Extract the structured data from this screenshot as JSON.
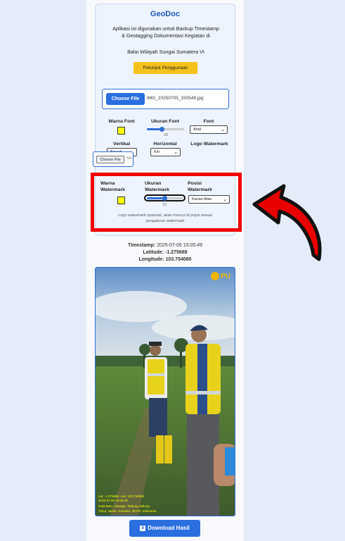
{
  "app": {
    "title": "GeoDoc",
    "description_line1": "Aplikasi ini digunakan untuk Backup Timestamp",
    "description_line2": "& Geotagging Dokumentasi Kegiatan di",
    "description_line3": "Balai Wilayah Sungai Sumatera VI",
    "guide_button": "Petunjuk Penggunaan"
  },
  "upload": {
    "choose_label": "Choose File",
    "file_name": "IMG_20250705_150549.jpg"
  },
  "settings": {
    "font_color_label": "Warna Font",
    "font_color": "#ffff00",
    "font_size_label": "Ukuran Font",
    "font_size_value": "28",
    "font_label": "Font",
    "font_value": "Arial",
    "vertical_label": "Vertikal",
    "vertical_value": "Bawah",
    "horizontal_label": "Horizontal",
    "horizontal_value": "Kiri",
    "logo_label": "Logo Watermark",
    "logo_choose_label": "Choose File",
    "logo_file_status": "Slo"
  },
  "watermark": {
    "color_label_1": "Warna",
    "color_label_2": "Watermark",
    "color": "#ffff00",
    "size_label_1": "Ukuran",
    "size_label_2": "Watermark",
    "size_value": "33",
    "position_label_1": "Posisi",
    "position_label_2": "Watermark",
    "position_value": "Kanan Atas",
    "note_line1": "Logo watermark opsional, akan muncul di pojok sesuai",
    "note_line2": "pengaturan watermark"
  },
  "info": {
    "timestamp_label": "Timestamp:",
    "timestamp_value": "2025-07-05 15:05:49",
    "latitude_label": "Latitude:",
    "latitude_value": "-1.275689",
    "longitude_label": "Longitude:",
    "longitude_value": "103.754080"
  },
  "photo": {
    "logo_text": "PU",
    "caption_line1": "Lat: -1.275689, Lon: 103.754080",
    "caption_line2": "2025-07-05 15:05:49",
    "caption_line3": "Kota Baru, Geragai, Tanjung Jabung",
    "caption_line4": "Timur, Jambi, Sumatra, 36764, Indonesia"
  },
  "download": {
    "label": "Download Hasil"
  },
  "colors": {
    "accent": "#2a6edf",
    "highlight": "#f00000",
    "guide_button": "#f5c21b"
  }
}
